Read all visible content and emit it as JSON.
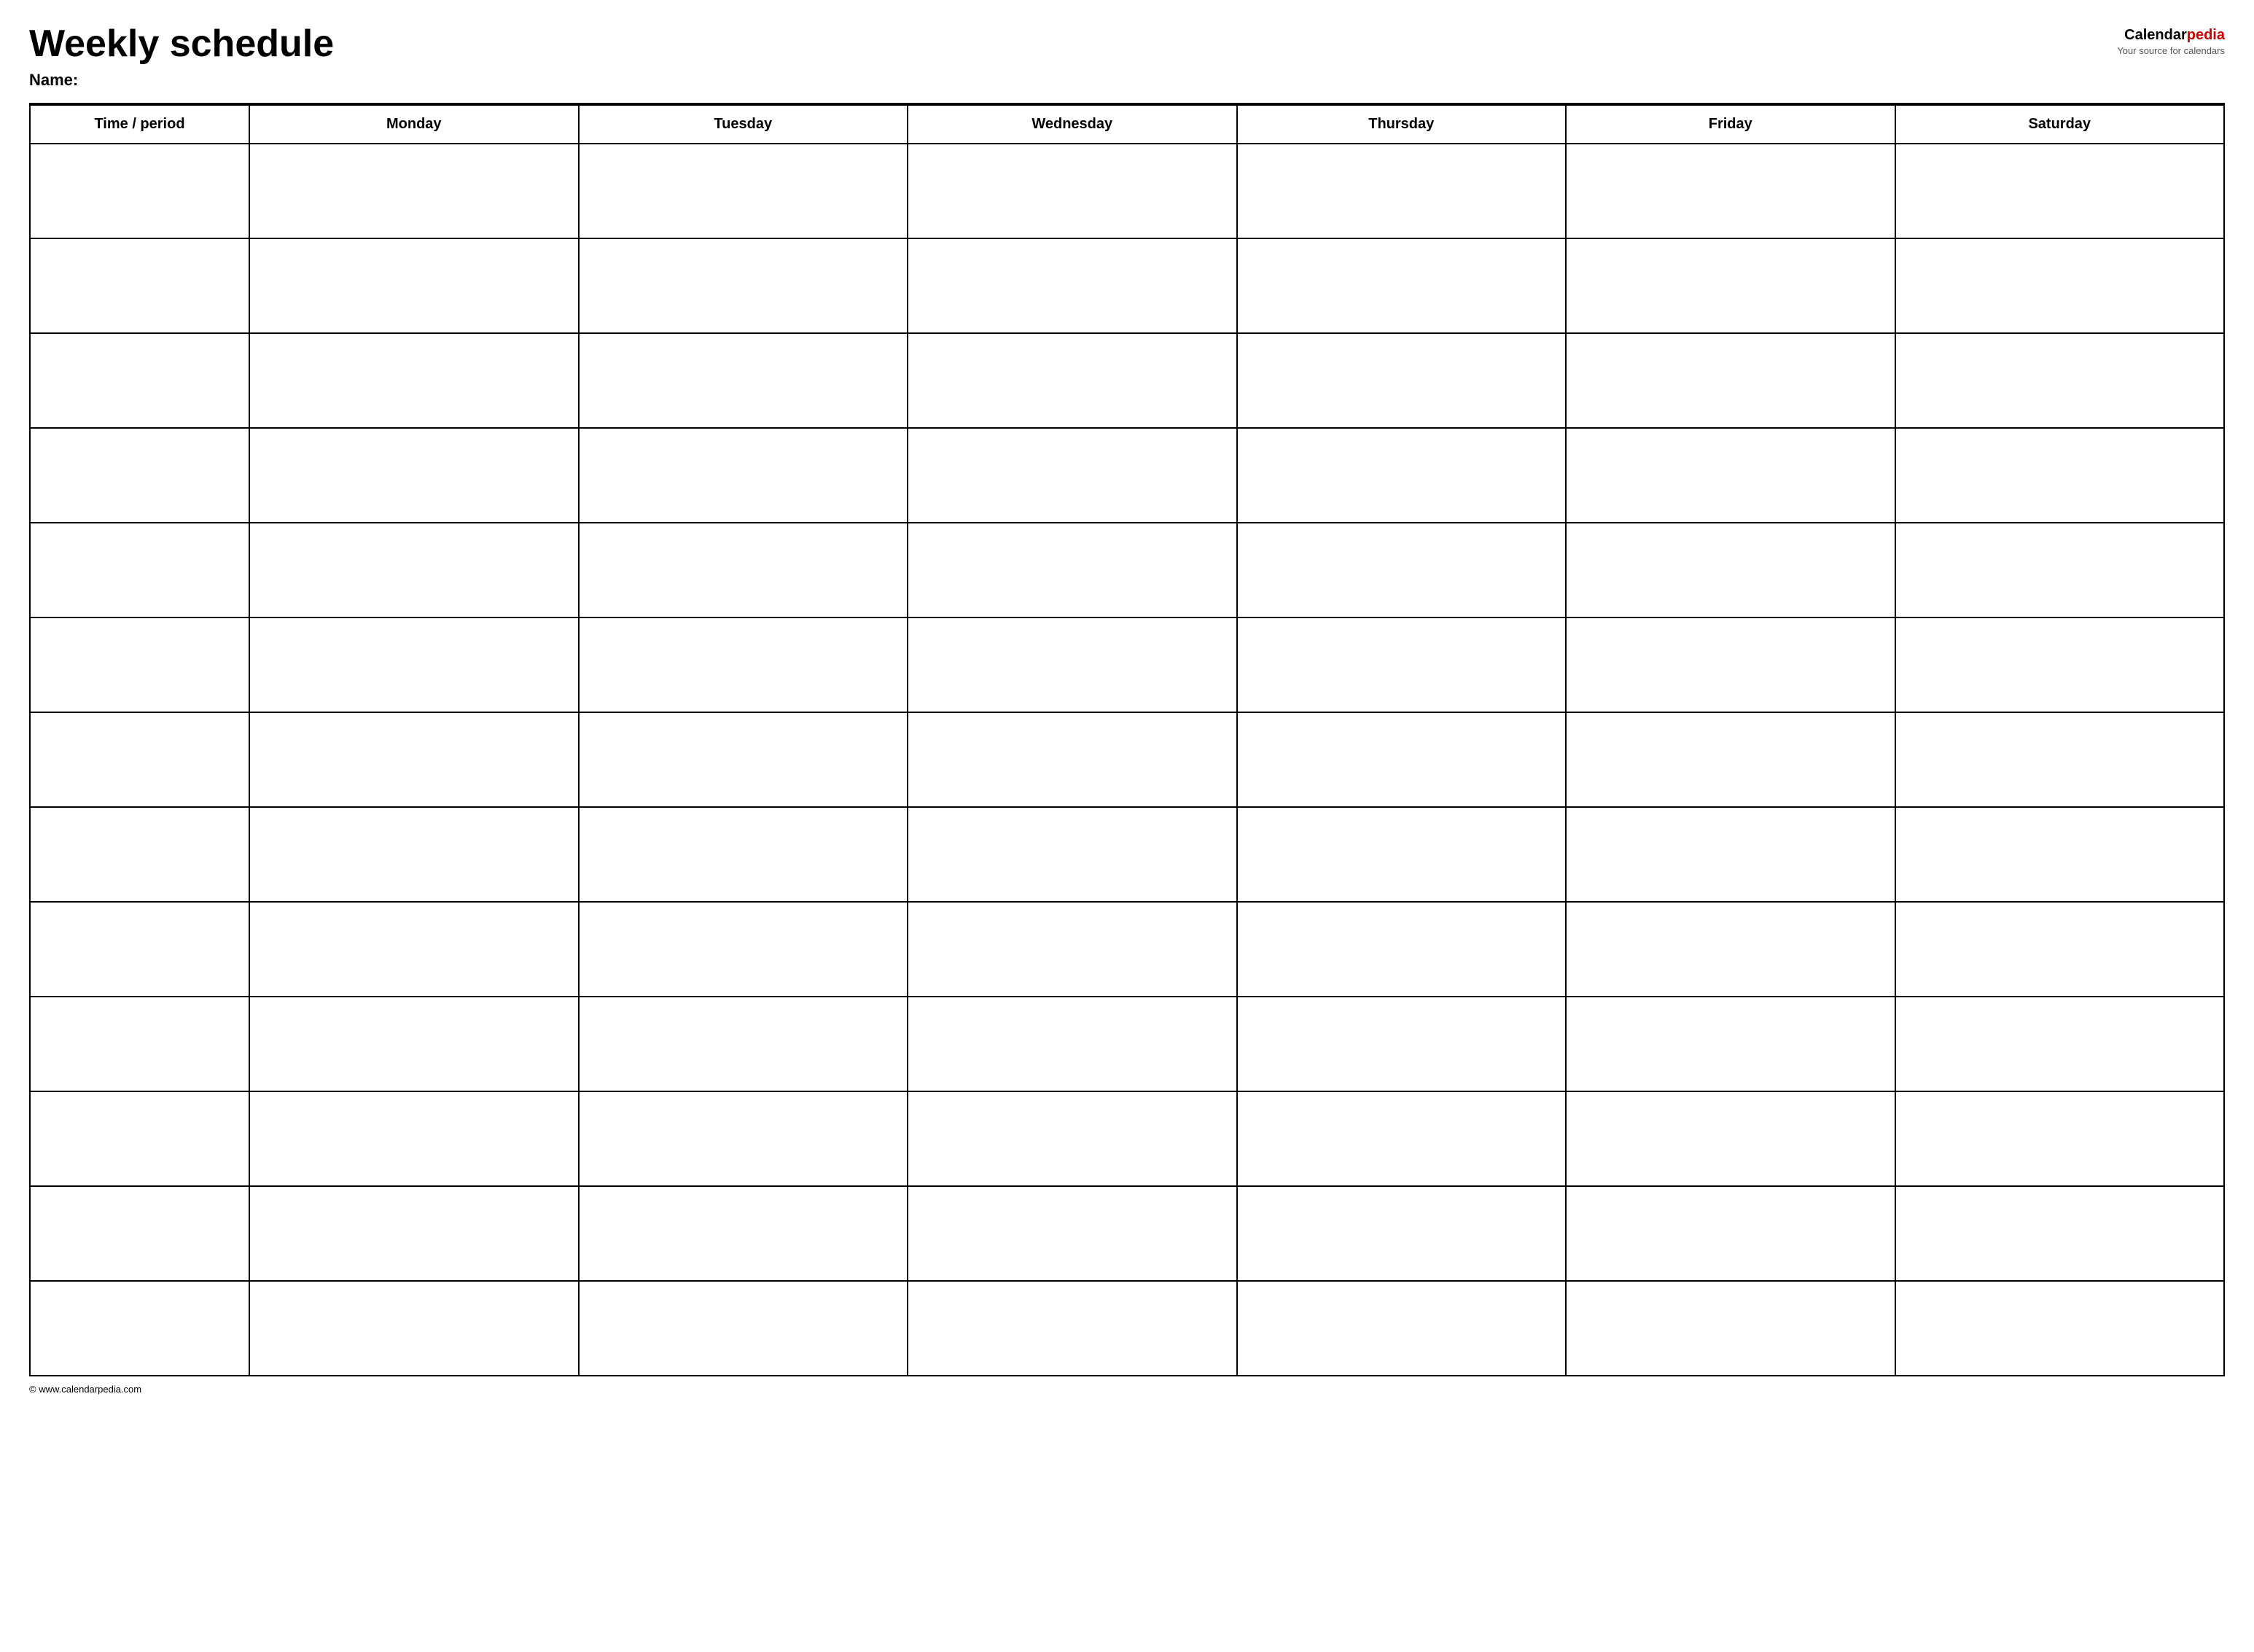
{
  "header": {
    "title": "Weekly schedule",
    "name_label": "Name:",
    "logo": {
      "brand_part1": "Calendar",
      "brand_part2": "pedia",
      "subtitle": "Your source for calendars"
    }
  },
  "table": {
    "columns": [
      {
        "key": "time",
        "label": "Time / period"
      },
      {
        "key": "monday",
        "label": "Monday"
      },
      {
        "key": "tuesday",
        "label": "Tuesday"
      },
      {
        "key": "wednesday",
        "label": "Wednesday"
      },
      {
        "key": "thursday",
        "label": "Thursday"
      },
      {
        "key": "friday",
        "label": "Friday"
      },
      {
        "key": "saturday",
        "label": "Saturday"
      }
    ],
    "row_count": 13
  },
  "footer": {
    "copyright": "© www.calendarpedia.com"
  }
}
